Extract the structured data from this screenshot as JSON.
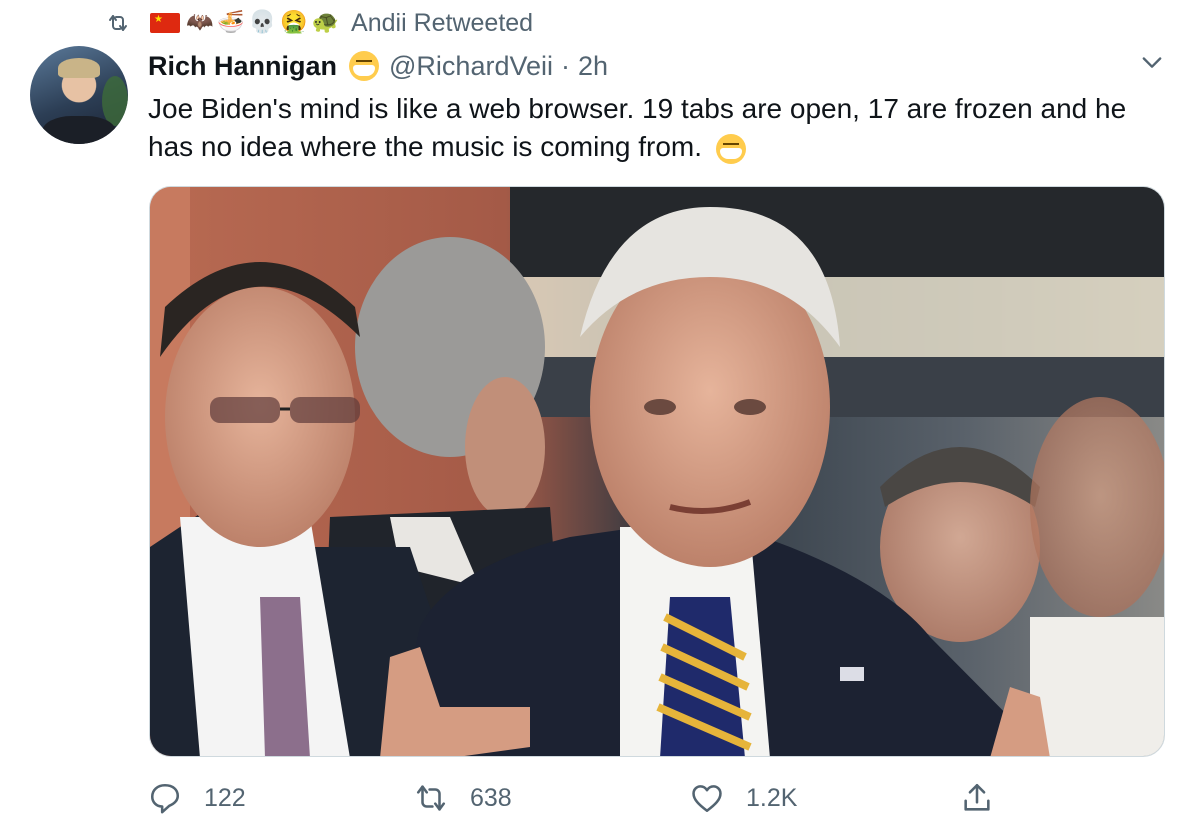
{
  "retweet": {
    "emojis": [
      "🦇",
      "🍜",
      "💀",
      "🤮",
      "🐢"
    ],
    "label": "Andii Retweeted"
  },
  "tweet": {
    "author_name": "Rich Hannigan",
    "handle": "@RichardVeii",
    "separator": "·",
    "time": "2h",
    "text": "Joe Biden's mind is like a web browser. 19 tabs are open, 17 are frozen and he has no idea where the music is coming from."
  },
  "actions": {
    "reply_count": "122",
    "retweet_count": "638",
    "like_count": "1.2K"
  },
  "icons": {
    "retweet_header": "retweet-icon",
    "more": "chevron-down-icon",
    "reply": "reply-icon",
    "retweet": "retweet-icon",
    "like": "heart-icon",
    "share": "share-icon"
  },
  "colors": {
    "secondary_text": "#536471",
    "primary_text": "#0f1419"
  }
}
